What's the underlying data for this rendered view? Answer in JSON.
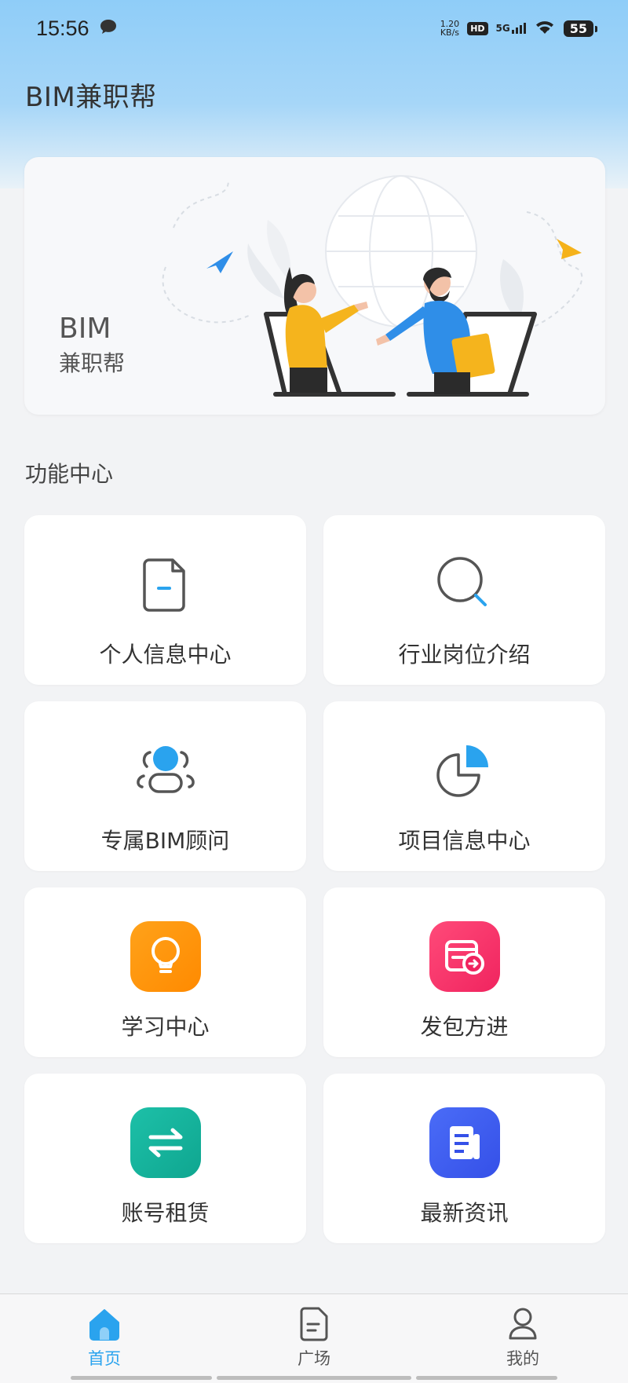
{
  "status_bar": {
    "time": "15:56",
    "net_speed_value": "1.20",
    "net_speed_unit": "KB/s",
    "hd": "HD",
    "network": "5G",
    "battery": "55"
  },
  "header": {
    "title": "BIM兼职帮"
  },
  "banner": {
    "line1": "BIM",
    "line2": "兼职帮"
  },
  "features": {
    "title": "功能中心",
    "items": [
      {
        "label": "个人信息中心",
        "icon": "document-icon"
      },
      {
        "label": "行业岗位介绍",
        "icon": "search-icon"
      },
      {
        "label": "专属BIM顾问",
        "icon": "user-group-icon"
      },
      {
        "label": "项目信息中心",
        "icon": "pie-chart-icon"
      },
      {
        "label": "学习中心",
        "icon": "lightbulb-icon"
      },
      {
        "label": "发包方进",
        "icon": "calendar-arrow-icon"
      },
      {
        "label": "账号租赁",
        "icon": "swap-arrows-icon"
      },
      {
        "label": "最新资讯",
        "icon": "news-icon"
      }
    ]
  },
  "tabbar": {
    "items": [
      {
        "label": "首页",
        "icon": "home-icon",
        "active": true
      },
      {
        "label": "广场",
        "icon": "file-icon",
        "active": false
      },
      {
        "label": "我的",
        "icon": "person-icon",
        "active": false
      }
    ]
  },
  "colors": {
    "accent": "#2aa3ee",
    "learning_tile": "#ff9a12",
    "contractor_tile": "#f8336d",
    "rental_tile": "#1ab7a0",
    "news_tile": "#3f5ff0"
  }
}
